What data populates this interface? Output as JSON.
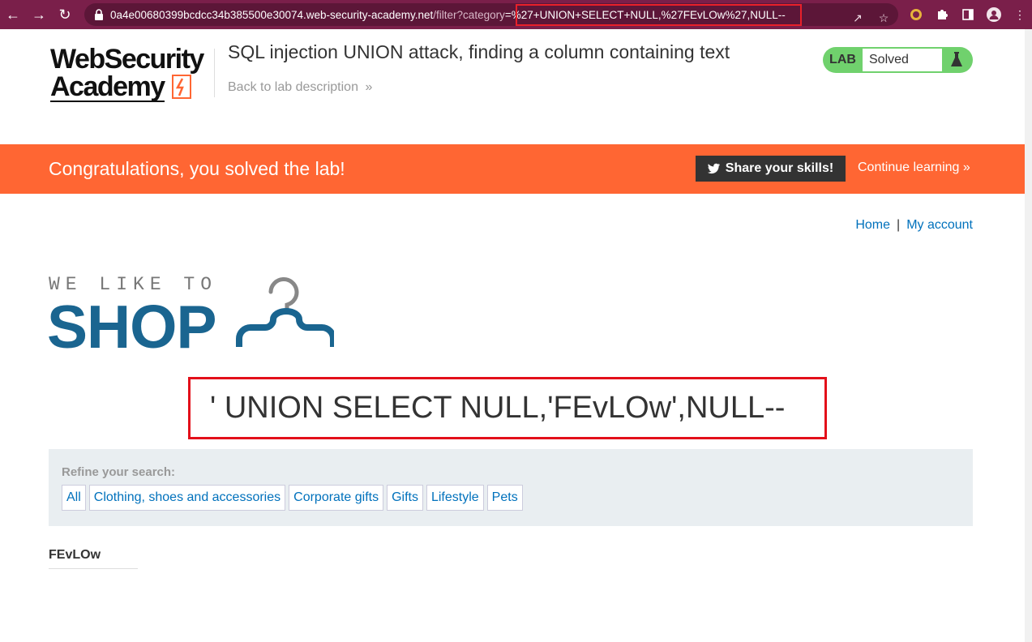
{
  "browser": {
    "url_host": "0a4e00680399bcdcc34b385500e30074.web-security-academy.net",
    "url_path": "/filter?category",
    "url_query": "=%27+UNION+SELECT+NULL,%27FEvLOw%27,NULL--"
  },
  "header": {
    "logo_line1": "WebSecurity",
    "logo_line2": "Academy",
    "lab_title": "SQL injection UNION attack, finding a column containing text",
    "back_link": "Back to lab description",
    "lab_tag": "LAB",
    "lab_status": "Solved"
  },
  "banner": {
    "message": "Congratulations, you solved the lab!",
    "share_label": "Share your skills!",
    "continue_label": "Continue learning"
  },
  "nav": {
    "home": "Home",
    "separator": "|",
    "account": "My account"
  },
  "shop": {
    "tagline": "WE LIKE TO",
    "word": "SHOP"
  },
  "page": {
    "heading": "' UNION SELECT NULL,'FEvLOw',NULL--"
  },
  "filter": {
    "label": "Refine your search:",
    "categories": [
      "All",
      "Clothing, shoes and accessories",
      "Corporate gifts",
      "Gifts",
      "Lifestyle",
      "Pets"
    ]
  },
  "results": [
    {
      "name": "FEvLOw"
    }
  ],
  "colors": {
    "chrome": "#7a1f4a",
    "banner": "#ff6633",
    "lab_green": "#70d16d",
    "link": "#0071bc",
    "shop_blue": "#1a6590",
    "highlight": "#e3101a"
  }
}
